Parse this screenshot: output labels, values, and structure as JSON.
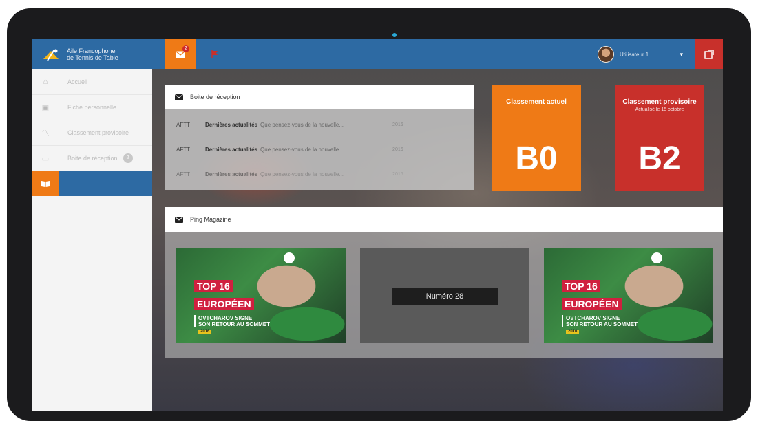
{
  "header": {
    "logo_line1": "Aile Francophone",
    "logo_line2": "de Tennis de Table",
    "mail_badge": "2",
    "user_name": "Utilisateur 1"
  },
  "sidebar": {
    "items": [
      {
        "label": "Accueil",
        "icon": "home-icon"
      },
      {
        "label": "Fiche personnelle",
        "icon": "id-card-icon"
      },
      {
        "label": "Classement provisoire",
        "icon": "trend-icon"
      },
      {
        "label": "Boite de réception",
        "icon": "inbox-icon",
        "count": "2"
      },
      {
        "label": "",
        "icon": "book-icon",
        "active": true
      }
    ]
  },
  "inbox": {
    "title": "Boite de réception",
    "messages": [
      {
        "sender": "AFTT",
        "subject": "Dernières actualités",
        "preview": "Que pensez-vous de la nouvelle...",
        "date": "2016"
      },
      {
        "sender": "AFTT",
        "subject": "Dernières actualités",
        "preview": "Que pensez-vous de la nouvelle...",
        "date": "2016"
      },
      {
        "sender": "AFTT",
        "subject": "Dernières actualités",
        "preview": "Que pensez-vous de la nouvelle...",
        "date": "2016"
      }
    ]
  },
  "ranking": {
    "current": {
      "title": "Classement actuel",
      "value": "B0"
    },
    "provisional": {
      "title": "Classement provisoire",
      "subtitle": "Actualisé le 15 octobre",
      "value": "B2"
    }
  },
  "magazine": {
    "title": "Ping Magazine",
    "cover_top": "TOP 16",
    "cover_euro": "EUROPÉEN",
    "cover_line1": "OVTCHAROV SIGNE",
    "cover_line2": "SON RETOUR AU SOMMET",
    "cover_small": "2016",
    "issue_label": "Numéro 28"
  },
  "colors": {
    "topbar": "#2d6aa3",
    "orange": "#ef7a16",
    "red": "#c8302b"
  }
}
